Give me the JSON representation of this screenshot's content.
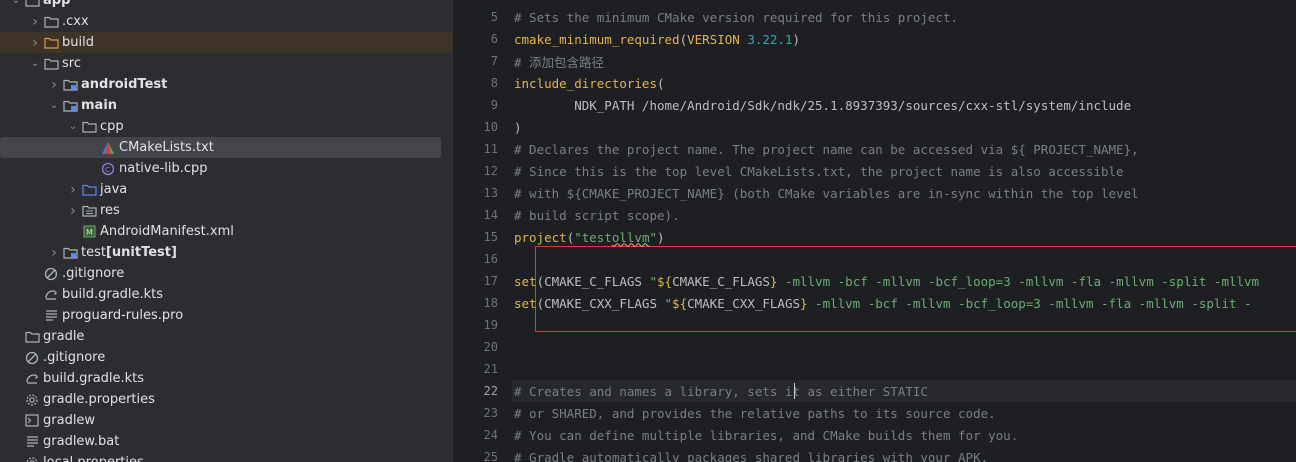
{
  "tree": {
    "items": [
      {
        "label": "app",
        "depth": 0,
        "expanded": true,
        "type": "folder",
        "bold": true
      },
      {
        "label": ".cxx",
        "depth": 1,
        "expanded": false,
        "type": "folder"
      },
      {
        "label": "build",
        "depth": 1,
        "expanded": false,
        "type": "folder-orange",
        "highlight": true
      },
      {
        "label": "src",
        "depth": 1,
        "expanded": true,
        "type": "folder"
      },
      {
        "label": "androidTest",
        "depth": 2,
        "expanded": false,
        "type": "folder-test",
        "bold": true
      },
      {
        "label": "main",
        "depth": 2,
        "expanded": true,
        "type": "folder-test",
        "bold": true
      },
      {
        "label": "cpp",
        "depth": 3,
        "expanded": true,
        "type": "folder"
      },
      {
        "label": "CMakeLists.txt",
        "depth": 4,
        "type": "cmake",
        "selected": true
      },
      {
        "label": "native-lib.cpp",
        "depth": 4,
        "type": "cpp"
      },
      {
        "label": "java",
        "depth": 3,
        "expanded": false,
        "type": "folder-blue"
      },
      {
        "label": "res",
        "depth": 3,
        "expanded": false,
        "type": "folder-res"
      },
      {
        "label": "AndroidManifest.xml",
        "depth": 3,
        "type": "manifest"
      },
      {
        "label": "test",
        "label_extra": "[unitTest]",
        "depth": 2,
        "expanded": false,
        "type": "folder-test"
      },
      {
        "label": ".gitignore",
        "depth": 1,
        "type": "gitignore"
      },
      {
        "label": "build.gradle.kts",
        "depth": 1,
        "type": "gradle"
      },
      {
        "label": "proguard-rules.pro",
        "depth": 1,
        "type": "text"
      },
      {
        "label": "gradle",
        "depth": 0,
        "type": "folder"
      },
      {
        "label": ".gitignore",
        "depth": 0,
        "type": "gitignore"
      },
      {
        "label": "build.gradle.kts",
        "depth": 0,
        "type": "gradle"
      },
      {
        "label": "gradle.properties",
        "depth": 0,
        "type": "gear"
      },
      {
        "label": "gradlew",
        "depth": 0,
        "type": "terminal"
      },
      {
        "label": "gradlew.bat",
        "depth": 0,
        "type": "text"
      },
      {
        "label": "local.properties",
        "depth": 0,
        "type": "gear"
      }
    ]
  },
  "editor": {
    "current_line": "22",
    "lines": [
      {
        "n": "5",
        "tokens": [
          {
            "t": "# Sets the minimum CMake version required for this project.",
            "c": "gc"
          }
        ]
      },
      {
        "n": "6",
        "tokens": [
          {
            "t": "cmake_minimum_required",
            "c": "kw"
          },
          {
            "t": "(",
            "c": ""
          },
          {
            "t": "VERSION ",
            "c": "kw2"
          },
          {
            "t": "3.22.1",
            "c": "num"
          },
          {
            "t": ")",
            "c": ""
          }
        ]
      },
      {
        "n": "7",
        "tokens": [
          {
            "t": "# 添加包含路径",
            "c": "gc"
          }
        ]
      },
      {
        "n": "8",
        "tokens": [
          {
            "t": "include_directories",
            "c": "kw"
          },
          {
            "t": "(",
            "c": ""
          }
        ]
      },
      {
        "n": "9",
        "tokens": [
          {
            "t": "        NDK_PATH /home/Android/Sdk/ndk/25.1.8937393/sources/cxx-stl/system/include",
            "c": ""
          }
        ]
      },
      {
        "n": "10",
        "tokens": [
          {
            "t": ")",
            "c": ""
          }
        ]
      },
      {
        "n": "11",
        "tokens": [
          {
            "t": "# Declares the project name. The project name can be accessed via ${ PROJECT_NAME},",
            "c": "gc"
          }
        ]
      },
      {
        "n": "12",
        "tokens": [
          {
            "t": "# Since this is the top level CMakeLists.txt, the project name is also accessible",
            "c": "gc"
          }
        ]
      },
      {
        "n": "13",
        "tokens": [
          {
            "t": "# with ${CMAKE_PROJECT_NAME} (both CMake variables are in-sync within the top level",
            "c": "gc"
          }
        ]
      },
      {
        "n": "14",
        "tokens": [
          {
            "t": "# build script scope).",
            "c": "gc"
          }
        ]
      },
      {
        "n": "15",
        "tokens": [
          {
            "t": "project",
            "c": "kw"
          },
          {
            "t": "(",
            "c": ""
          },
          {
            "t": "\"test",
            "c": "str"
          },
          {
            "t": "ollvm",
            "c": "str squig"
          },
          {
            "t": "\"",
            "c": "str"
          },
          {
            "t": ")",
            "c": ""
          }
        ]
      },
      {
        "n": "16",
        "tokens": []
      },
      {
        "n": "17",
        "tokens": [
          {
            "t": "set",
            "c": "kw"
          },
          {
            "t": "(CMAKE_C_FLAGS ",
            "c": ""
          },
          {
            "t": "\"",
            "c": "str"
          },
          {
            "t": "${",
            "c": "kw"
          },
          {
            "t": "CMAKE_C_FLAGS",
            "c": ""
          },
          {
            "t": "}",
            "c": "kw"
          },
          {
            "t": " -mllvm -bcf -mllvm -bcf_loop=3 -mllvm -fla -mllvm -split -mllvm",
            "c": "str"
          }
        ]
      },
      {
        "n": "18",
        "tokens": [
          {
            "t": "set",
            "c": "kw"
          },
          {
            "t": "(CMAKE_CXX_FLAGS ",
            "c": ""
          },
          {
            "t": "\"",
            "c": "str"
          },
          {
            "t": "${",
            "c": "kw"
          },
          {
            "t": "CMAKE_CXX_FLAGS",
            "c": ""
          },
          {
            "t": "}",
            "c": "kw"
          },
          {
            "t": " -mllvm -bcf -mllvm -bcf_loop=3 -mllvm -fla -mllvm -split -",
            "c": "str"
          }
        ]
      },
      {
        "n": "19",
        "tokens": []
      },
      {
        "n": "20",
        "tokens": []
      },
      {
        "n": "21",
        "tokens": []
      },
      {
        "n": "22",
        "tokens": [
          {
            "t": "# Creates and names a library, sets it as either STATIC",
            "c": "gc"
          }
        ]
      },
      {
        "n": "23",
        "tokens": [
          {
            "t": "# or SHARED, and provides the relative paths to its source code.",
            "c": "gc"
          }
        ]
      },
      {
        "n": "24",
        "tokens": [
          {
            "t": "# You can define multiple libraries, and CMake builds them for you.",
            "c": "gc"
          }
        ]
      },
      {
        "n": "25",
        "tokens": [
          {
            "t": "# Gradle automatically packages shared libraries with your APK.",
            "c": "gc"
          }
        ]
      }
    ]
  },
  "colors": {
    "tree_bg": "#2b2d30",
    "editor_bg": "#1e1f22",
    "selection": "#43454a",
    "keyword": "#e0b54e",
    "string": "#6aab73",
    "number": "#2aacb8",
    "comment": "#7a7e85",
    "annotation_box": "#d43b3b"
  }
}
